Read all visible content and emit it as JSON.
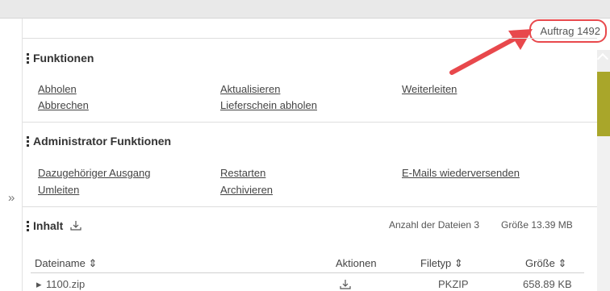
{
  "order": {
    "label": "Auftrag 1492"
  },
  "functions": {
    "title": "Funktionen",
    "links": [
      "Abholen",
      "Abbrechen",
      "Aktualisieren",
      "Lieferschein abholen",
      "Weiterleiten"
    ]
  },
  "admin": {
    "title": "Administrator Funktionen",
    "links": [
      "Dazugehöriger Ausgang",
      "Umleiten",
      "Restarten",
      "Archivieren",
      "E-Mails wiederversenden"
    ]
  },
  "content": {
    "title": "Inhalt",
    "file_count": "Anzahl der Dateien 3",
    "size": "Größe 13.39 MB",
    "columns": [
      "Dateiname ⇕",
      "Aktionen",
      "Filetyp ⇕",
      "Größe ⇕"
    ],
    "rows": [
      {
        "name": "1100.zip",
        "type": "PKZIP",
        "size": "658.89 KB"
      }
    ]
  },
  "icons": {
    "collapse": "double-chevron-right-icon",
    "download": "download-icon",
    "scroll_up": "chevron-up-icon",
    "annotation_arrow": "red-arrow-icon"
  },
  "colors": {
    "accent": "#a9a62a",
    "annotation": "#e8484c"
  }
}
